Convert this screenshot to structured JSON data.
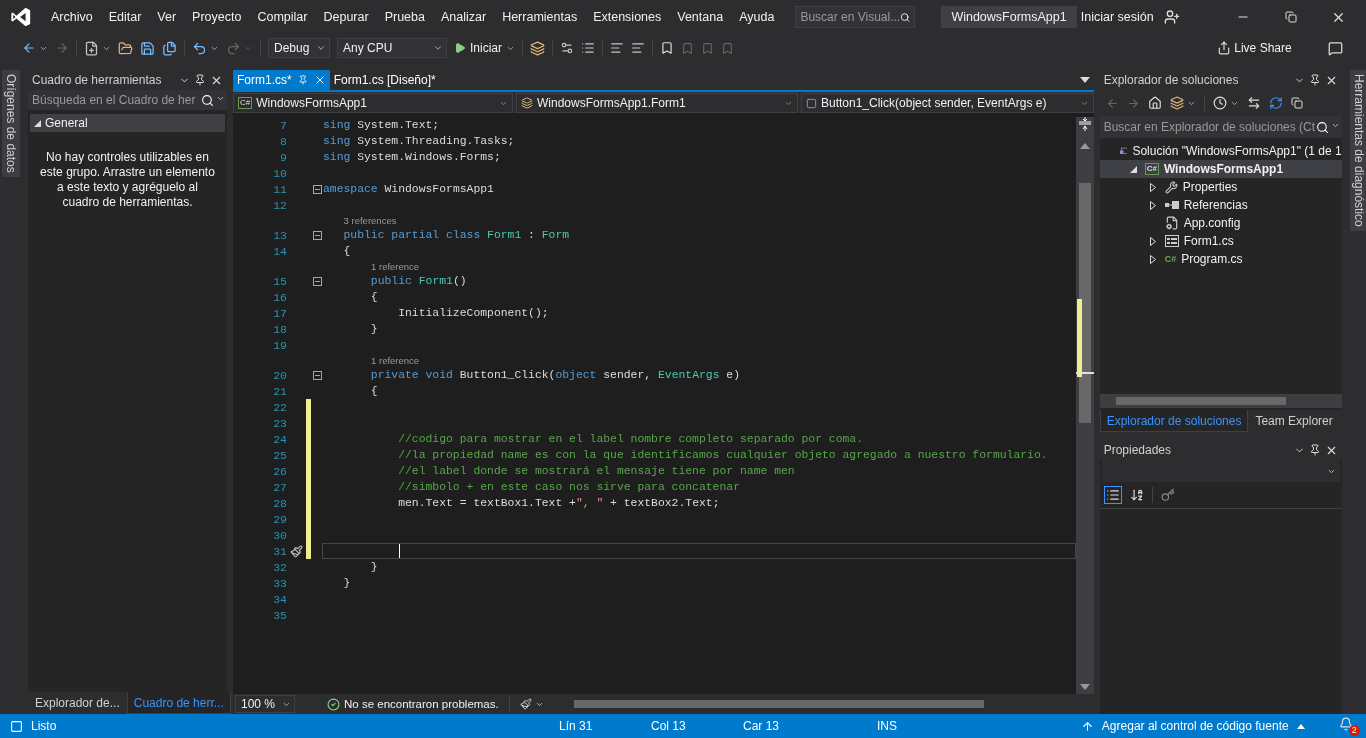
{
  "menu": [
    "Archivo",
    "Editar",
    "Ver",
    "Proyecto",
    "Compilar",
    "Depurar",
    "Prueba",
    "Analizar",
    "Herramientas",
    "Extensiones",
    "Ventana",
    "Ayuda"
  ],
  "search": {
    "placeholder": "Buscar en Visual..."
  },
  "window": {
    "title": "WindowsFormsApp1"
  },
  "account": {
    "label": "Iniciar sesión"
  },
  "toolbar": {
    "configuration": "Debug",
    "platform": "Any CPU",
    "start": "Iniciar",
    "live_share": "Live Share"
  },
  "left_strip": {
    "label": "Orígenes de datos"
  },
  "toolbox": {
    "title": "Cuadro de herramientas",
    "search_placeholder": "Búsqueda en el Cuadro de her",
    "group": {
      "label": "General",
      "expanded": true
    },
    "message": "No hay controles utilizables en este grupo. Arrastre un elemento a este texto y agréguelo al cuadro de herramientas.",
    "tabs": [
      {
        "label": "Explorador de...",
        "selected": false
      },
      {
        "label": "Cuadro de herr...",
        "selected": true
      }
    ]
  },
  "editor": {
    "tabs": [
      {
        "label": "Form1.cs*",
        "selected": true
      },
      {
        "label": "Form1.cs [Diseño]*",
        "selected": false
      }
    ],
    "nav": [
      {
        "label": "WindowsFormsApp1",
        "kind": "project",
        "badge": "C#"
      },
      {
        "label": "WindowsFormsApp1.Form1",
        "kind": "class"
      },
      {
        "label": "Button1_Click(object sender, EventArgs e)",
        "kind": "method"
      }
    ],
    "lines": [
      {
        "kind": "code",
        "number": "7",
        "modified": false,
        "fold": false,
        "current": false,
        "tokens": [
          {
            "kind": "keyword",
            "text": "sing"
          },
          {
            "kind": "plain",
            "text": " System.Text;"
          }
        ]
      },
      {
        "kind": "code",
        "number": "8",
        "modified": false,
        "fold": false,
        "current": false,
        "tokens": [
          {
            "kind": "keyword",
            "text": "sing"
          },
          {
            "kind": "plain",
            "text": " System.Threading.Tasks;"
          }
        ]
      },
      {
        "kind": "code",
        "number": "9",
        "modified": false,
        "fold": false,
        "current": false,
        "tokens": [
          {
            "kind": "keyword",
            "text": "sing"
          },
          {
            "kind": "plain",
            "text": " System.Windows.Forms;"
          }
        ]
      },
      {
        "kind": "code",
        "number": "10",
        "modified": false,
        "fold": false,
        "current": false
      },
      {
        "kind": "code",
        "number": "11",
        "modified": false,
        "fold": true,
        "current": false,
        "tokens": [
          {
            "kind": "keyword",
            "text": "amespace"
          },
          {
            "kind": "plain",
            "text": " WindowsFormsApp1"
          }
        ]
      },
      {
        "kind": "code",
        "number": "12",
        "modified": false,
        "fold": false,
        "current": false
      },
      {
        "kind": "lens",
        "text": "3 references"
      },
      {
        "kind": "code",
        "number": "13",
        "modified": false,
        "fold": true,
        "current": false,
        "tokens": [
          {
            "kind": "keyword",
            "text": "   public partial class"
          },
          {
            "kind": "type",
            "text": " Form1"
          },
          {
            "kind": "plain",
            "text": " :"
          },
          {
            "kind": "type",
            "text": " Form"
          }
        ]
      },
      {
        "kind": "code",
        "number": "14",
        "modified": false,
        "fold": false,
        "current": false,
        "tokens": [
          {
            "kind": "plain",
            "text": "   {"
          }
        ]
      },
      {
        "kind": "lens",
        "text": "1 reference"
      },
      {
        "kind": "code",
        "number": "15",
        "modified": false,
        "fold": true,
        "current": false,
        "tokens": [
          {
            "kind": "keyword",
            "text": "       public"
          },
          {
            "kind": "type",
            "text": " Form1"
          },
          {
            "kind": "plain",
            "text": "()"
          }
        ]
      },
      {
        "kind": "code",
        "number": "16",
        "modified": false,
        "fold": false,
        "current": false,
        "tokens": [
          {
            "kind": "plain",
            "text": "       {"
          }
        ]
      },
      {
        "kind": "code",
        "number": "17",
        "modified": false,
        "fold": false,
        "current": false,
        "tokens": [
          {
            "kind": "plain",
            "text": "           InitializeComponent();"
          }
        ]
      },
      {
        "kind": "code",
        "number": "18",
        "modified": false,
        "fold": false,
        "current": false,
        "tokens": [
          {
            "kind": "plain",
            "text": "       }"
          }
        ]
      },
      {
        "kind": "code",
        "number": "19",
        "modified": false,
        "fold": false,
        "current": false
      },
      {
        "kind": "lens",
        "text": "1 reference"
      },
      {
        "kind": "code",
        "number": "20",
        "modified": false,
        "fold": true,
        "current": false,
        "tokens": [
          {
            "kind": "keyword",
            "text": "       private void"
          },
          {
            "kind": "plain",
            "text": " Button1_Click("
          },
          {
            "kind": "keyword",
            "text": "object"
          },
          {
            "kind": "plain",
            "text": " sender,"
          },
          {
            "kind": "type",
            "text": " EventArgs"
          },
          {
            "kind": "plain",
            "text": " e)"
          }
        ]
      },
      {
        "kind": "code",
        "number": "21",
        "modified": false,
        "fold": false,
        "current": false,
        "tokens": [
          {
            "kind": "plain",
            "text": "       {"
          }
        ]
      },
      {
        "kind": "code",
        "number": "22",
        "modified": true,
        "fold": false,
        "current": false
      },
      {
        "kind": "code",
        "number": "23",
        "modified": true,
        "fold": false,
        "current": false
      },
      {
        "kind": "code",
        "number": "24",
        "modified": true,
        "fold": false,
        "current": false,
        "tokens": [
          {
            "kind": "comment",
            "text": "           //codigo para mostrar en el label nombre completo separado por coma."
          }
        ]
      },
      {
        "kind": "code",
        "number": "25",
        "modified": true,
        "fold": false,
        "current": false,
        "tokens": [
          {
            "kind": "comment",
            "text": "           //la propiedad name es con la que identificamos cualquier objeto agregado a nuestro formulario."
          }
        ]
      },
      {
        "kind": "code",
        "number": "26",
        "modified": true,
        "fold": false,
        "current": false,
        "tokens": [
          {
            "kind": "comment",
            "text": "           //el label donde se mostrará el mensaje tiene por name men"
          }
        ]
      },
      {
        "kind": "code",
        "number": "27",
        "modified": true,
        "fold": false,
        "current": false,
        "tokens": [
          {
            "kind": "comment",
            "text": "           //simbolo + en este caso nos sirve para concatenar"
          }
        ]
      },
      {
        "kind": "code",
        "number": "28",
        "modified": true,
        "fold": false,
        "current": false,
        "tokens": [
          {
            "kind": "plain",
            "text": "           men.Text = textBox1.Text +"
          },
          {
            "kind": "string",
            "text": "\", \""
          },
          {
            "kind": "plain",
            "text": " + textBox2.Text;"
          }
        ]
      },
      {
        "kind": "code",
        "number": "29",
        "modified": true,
        "fold": false,
        "current": false
      },
      {
        "kind": "code",
        "number": "30",
        "modified": true,
        "fold": false,
        "current": false
      },
      {
        "kind": "code",
        "number": "31",
        "modified": true,
        "fold": false,
        "current": true
      },
      {
        "kind": "code",
        "number": "32",
        "modified": false,
        "fold": false,
        "current": false,
        "tokens": [
          {
            "kind": "plain",
            "text": "       }"
          }
        ]
      },
      {
        "kind": "code",
        "number": "33",
        "modified": false,
        "fold": false,
        "current": false,
        "tokens": [
          {
            "kind": "plain",
            "text": "   }"
          }
        ]
      },
      {
        "kind": "code",
        "number": "34",
        "modified": false,
        "fold": false,
        "current": false
      },
      {
        "kind": "code",
        "number": "35",
        "modified": false,
        "fold": false,
        "current": false
      }
    ],
    "zoom": "100 %",
    "issues": "No se encontraron problemas."
  },
  "solution_explorer": {
    "title": "Explorador de soluciones",
    "search_placeholder": "Buscar en Explorador de soluciones (Ct",
    "tree": [
      {
        "label": "Solución \"WindowsFormsApp1\" (1 de 1",
        "kind": "solution",
        "selected": false,
        "children": [
          {
            "label": "WindowsFormsApp1",
            "kind": "project",
            "badge": "C#",
            "expanded": true,
            "selected": true,
            "children": [
              {
                "label": "Properties",
                "kind": "wrench",
                "expanded": false,
                "selected": false
              },
              {
                "label": "Referencias",
                "kind": "references",
                "expanded": false,
                "selected": false
              },
              {
                "label": "App.config",
                "kind": "config",
                "selected": false
              },
              {
                "label": "Form1.cs",
                "kind": "form",
                "expanded": false,
                "selected": false
              },
              {
                "label": "Program.cs",
                "kind": "csharp",
                "badge": "C#",
                "expanded": false,
                "selected": false
              }
            ]
          }
        ]
      }
    ],
    "tabs": [
      {
        "label": "Explorador de soluciones",
        "selected": true
      },
      {
        "label": "Team Explorer",
        "selected": false
      }
    ]
  },
  "properties": {
    "title": "Propiedades"
  },
  "right_strip": {
    "label": "Herramientas de diagnóstico"
  },
  "status_bar": {
    "state": "Listo",
    "line": "Lín 31",
    "column": "Col 13",
    "char": "Car 13",
    "mode": "INS",
    "source_control": "Agregar al control de código fuente",
    "notifications": "2"
  }
}
